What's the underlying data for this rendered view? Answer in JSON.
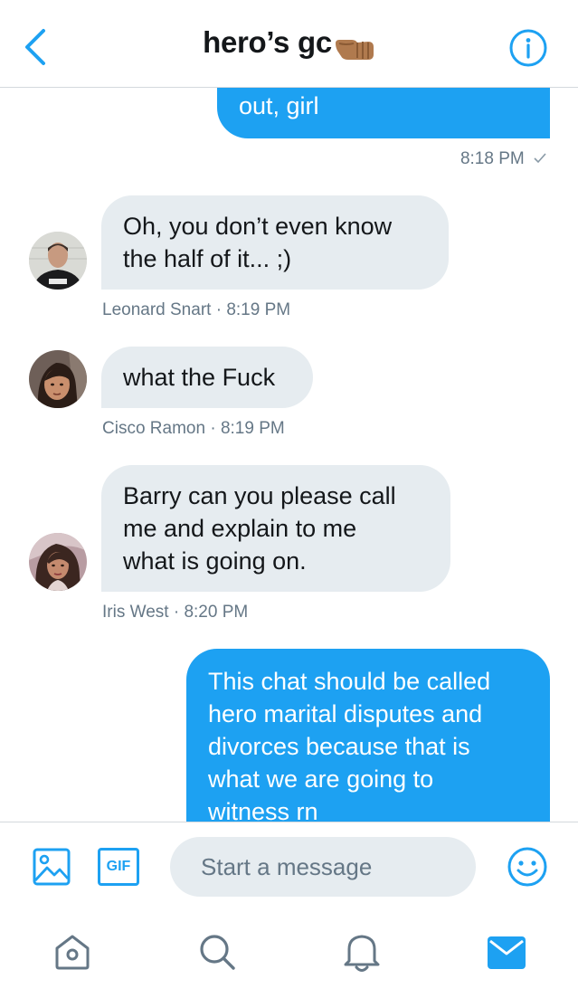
{
  "header": {
    "title": "hero’s gc",
    "back_icon": "chevron-left-icon",
    "info_icon": "info-icon",
    "accent": "#1da1f2"
  },
  "messages": [
    {
      "type": "out",
      "lines": [
        "out, girl"
      ],
      "time": "8:18 PM"
    },
    {
      "type": "in",
      "lines": [
        "Oh, you don’t even know",
        "the half of it... ;)"
      ],
      "sender": "Leonard Snart",
      "separator": "·",
      "time": "8:19 PM"
    },
    {
      "type": "in",
      "lines": [
        "what the Fuck"
      ],
      "sender": "Cisco Ramon",
      "separator": "·",
      "time": "8:19 PM"
    },
    {
      "type": "in",
      "lines": [
        "Barry can you please call",
        "me and explain to me",
        "what is going on."
      ],
      "sender": "Iris West",
      "separator": "·",
      "time": "8:20 PM"
    },
    {
      "type": "out",
      "lines": [
        "This chat should be called",
        "hero marital disputes and",
        "divorces because that is",
        "what we are going to",
        "witness rn"
      ]
    }
  ],
  "composer": {
    "placeholder": "Start a message",
    "gif_label": "GIF",
    "image_icon": "image-icon",
    "emoji_icon": "emoji-icon"
  },
  "tabs": [
    "home-icon",
    "search-icon",
    "notifications-icon",
    "messages-icon"
  ],
  "colors": {
    "outgoing": "#1da1f2",
    "incoming": "#e6ecf0",
    "meta": "#657786",
    "icon": "#657786"
  }
}
